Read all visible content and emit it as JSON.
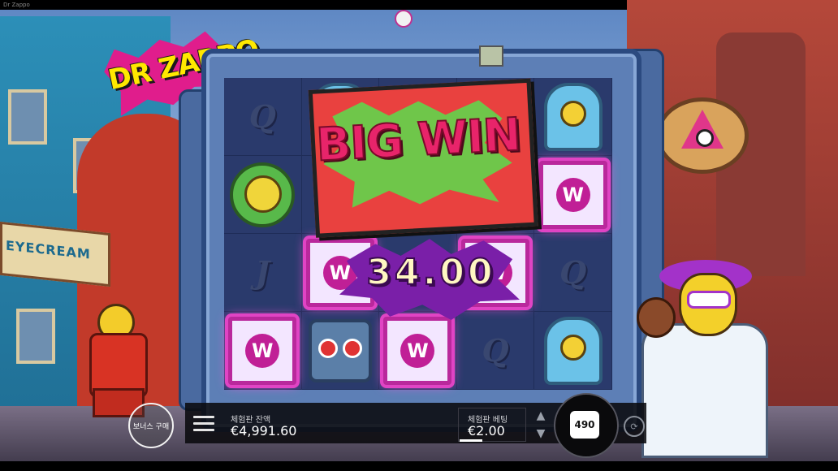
{
  "window": {
    "title": "Dr Zappo"
  },
  "game": {
    "logo": "DR ZAPPO",
    "shop_sign": "EYECREAM",
    "big_win_text": "BIG WIN",
    "win_amount": "34.00",
    "reels": [
      [
        "Q",
        "alien-symbol",
        "alien-symbol",
        "alien-symbol",
        "alien-symbol"
      ],
      [
        "clown-symbol",
        "clown-symbol",
        "alien-symbol",
        "robot-symbol",
        "W"
      ],
      [
        "J",
        "W",
        "alien-symbol",
        "W",
        "Q"
      ],
      [
        "alien-symbol",
        "W",
        "robot-symbol",
        "W",
        "alien-symbol"
      ]
    ],
    "reel_letters": {
      "r0c0": "Q",
      "r2c0": "J",
      "r2c4": "Q",
      "r3c3": "Q",
      "w_symbol": "W"
    },
    "autoplay_badge": "보너스 구매"
  },
  "controls": {
    "balance_label": "체험판 잔액",
    "balance_value": "€4,991.60",
    "bet_label": "체험판 베팅",
    "bet_value": "€2.00",
    "spin_label": "490",
    "bet_up": "▲",
    "bet_down": "▼",
    "autoplay_icon": "⟳"
  },
  "colors": {
    "accent_pink": "#e01d8c",
    "logo_yellow": "#ffe800",
    "big_win_red": "#e9413f",
    "win_purple": "#7a1fa8",
    "bar_bg": "#0a0a0e"
  },
  "icons": [
    "menu-icon",
    "arrow-up-icon",
    "arrow-down-icon",
    "autoplay-icon",
    "eye-icon"
  ]
}
